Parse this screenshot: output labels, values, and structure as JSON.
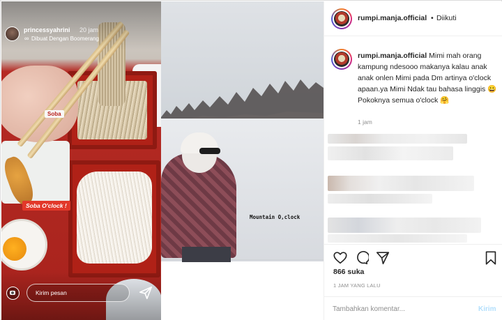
{
  "story_left": {
    "username": "princessyahrini",
    "time": "20 jam",
    "boomerang_label": "Dibuat Dengan Boomerang",
    "sticker": "Soba O'clock !",
    "label_tag": "Soba",
    "reply_placeholder": "Kirim pesan"
  },
  "story_middle": {
    "caption": "Mountain O,clock"
  },
  "post": {
    "header_username": "rumpi.manja.official",
    "header_separator": "•",
    "follow_status": "Diikuti",
    "comment_username": "rumpi.manja.official",
    "comment_text": "Mimi mah orang kampung ndesooo makanya kalau anak anak onlen Mimi pada Dm artinya o'clock apaan.ya Mimi Ndak tau bahasa linggis 😀",
    "comment_text_2": "Pokoknya semua o'clock 🤗",
    "comment_time": "1 jam",
    "likes": "866 suka",
    "posted_time": "1 JAM YANG LALU",
    "comment_placeholder": "Tambahkan komentar...",
    "send_label": "Kirim"
  },
  "colors": {
    "text": "#262626",
    "muted": "#8e8e8e",
    "send_disabled": "#b2dffc",
    "sticker_red": "#e2382a"
  },
  "icons": [
    "camera-icon",
    "send-icon",
    "heart-icon",
    "comment-icon",
    "share-icon",
    "bookmark-icon",
    "boomerang-icon"
  ]
}
